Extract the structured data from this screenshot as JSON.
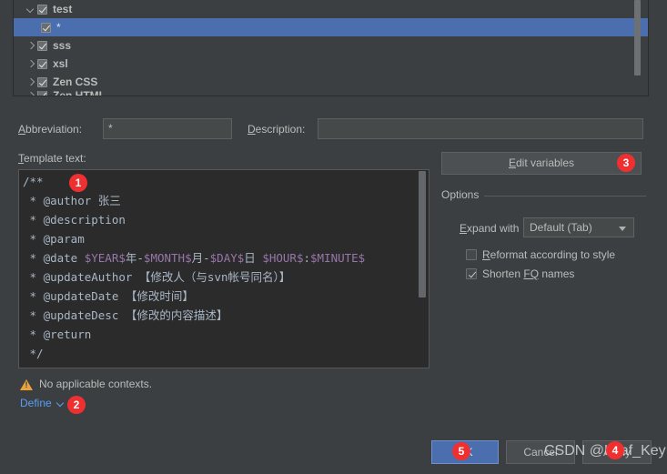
{
  "tree": {
    "rows": [
      {
        "label": "test",
        "arrow": "expanded",
        "checked": true,
        "indent": 0,
        "selected": false
      },
      {
        "label": "*",
        "arrow": "none",
        "checked": true,
        "indent": 1,
        "selected": true
      },
      {
        "label": "sss",
        "arrow": "collapsed",
        "checked": true,
        "indent": 0,
        "selected": false
      },
      {
        "label": "xsl",
        "arrow": "collapsed",
        "checked": true,
        "indent": 0,
        "selected": false
      },
      {
        "label": "Zen CSS",
        "arrow": "collapsed",
        "checked": true,
        "indent": 0,
        "selected": false
      },
      {
        "label": "Zen HTML",
        "arrow": "collapsed",
        "checked": true,
        "indent": 0,
        "selected": false
      }
    ]
  },
  "fields": {
    "abbreviation_label": "Abbreviation:",
    "abbreviation_mnemonic": "A",
    "abbreviation_value": "*",
    "description_label": "Description:",
    "description_mnemonic": "D",
    "description_value": ""
  },
  "template": {
    "label": "Template text:",
    "label_mnemonic": "T",
    "lines": [
      "/**",
      " * @author 张三",
      " * @description",
      " * @param",
      " * @date $YEAR$年-$MONTH$月-$DAY$日 $HOUR$:$MINUTE$",
      " * @updateAuthor 【修改人（与svn帐号同名）】",
      " * @updateDate 【修改时间】",
      " * @updateDesc 【修改的内容描述】",
      " * @return",
      " */"
    ]
  },
  "edit_variables": {
    "label": "Edit variables",
    "mnemonic": "E"
  },
  "options": {
    "title": "Options",
    "expand_with_label": "Expand with",
    "expand_with_mnemonic": "E",
    "expand_with_value": "Default (Tab)",
    "reformat_label": "Reformat according to style",
    "reformat_mnemonic": "R",
    "reformat_checked": false,
    "shorten_label": "Shorten FQ names",
    "shorten_mnemonic": "FQ",
    "shorten_checked": true
  },
  "context": {
    "warning_text": "No applicable contexts.",
    "define_label": "Define"
  },
  "buttons": {
    "ok": "OK",
    "cancel": "Cancel",
    "apply": "Apply"
  },
  "badges": {
    "b1": "1",
    "b2": "2",
    "b3": "3",
    "b4": "4",
    "b5": "5"
  },
  "watermark": "CSDN @Leaf_Key",
  "colors": {
    "background": "#3c3f41",
    "editor_background": "#2b2b2b",
    "selection": "#4b6eaf",
    "accent_link": "#589df6",
    "badge": "#f03030",
    "warning": "#e8a33d",
    "template_variable": "#9876aa",
    "code_text": "#a9b7c6"
  }
}
